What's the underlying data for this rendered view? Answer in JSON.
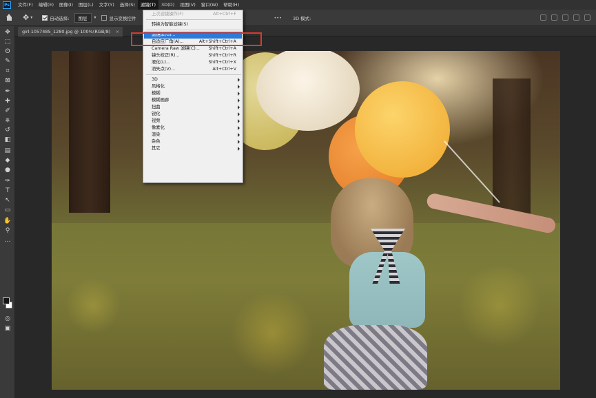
{
  "app": {
    "logo": "Ps"
  },
  "menubar": {
    "items": [
      "文件(F)",
      "编辑(E)",
      "图像(I)",
      "图层(L)",
      "文字(Y)",
      "选择(S)",
      "滤镜(T)",
      "3D(D)",
      "视图(V)",
      "窗口(W)",
      "帮助(H)"
    ],
    "active_index": 6
  },
  "options_bar": {
    "auto_select_label": "自动选择:",
    "auto_select_value": "图层",
    "show_transform_label": "显示变换控件",
    "mode_3d_label": "3D 模式:"
  },
  "document_tab": {
    "title": "girl-1057485_1280.jpg @ 100%(RGB/8)",
    "close": "×"
  },
  "filter_menu": {
    "items": [
      {
        "label": "上次滤镜操作(F)",
        "shortcut": "Alt+Ctrl+F",
        "disabled": true,
        "submenu": false
      },
      {
        "separator": true
      },
      {
        "label": "转换为智能滤镜(S)",
        "shortcut": "",
        "disabled": false,
        "submenu": false
      },
      {
        "separator": true
      },
      {
        "label": "滤镜库(G)...",
        "shortcut": "",
        "disabled": false,
        "submenu": false,
        "highlight": true
      },
      {
        "label": "自适应广角(A)...",
        "shortcut": "Alt+Shift+Ctrl+A",
        "disabled": false,
        "submenu": false
      },
      {
        "label": "Camera Raw 滤镜(C)...",
        "shortcut": "Shift+Ctrl+A",
        "disabled": false,
        "submenu": false
      },
      {
        "label": "镜头校正(R)...",
        "shortcut": "Shift+Ctrl+R",
        "disabled": false,
        "submenu": false
      },
      {
        "label": "液化(L)...",
        "shortcut": "Shift+Ctrl+X",
        "disabled": false,
        "submenu": false
      },
      {
        "label": "消失点(V)...",
        "shortcut": "Alt+Ctrl+V",
        "disabled": false,
        "submenu": false
      },
      {
        "separator": true
      },
      {
        "label": "3D",
        "shortcut": "",
        "disabled": false,
        "submenu": true
      },
      {
        "label": "风格化",
        "shortcut": "",
        "disabled": false,
        "submenu": true
      },
      {
        "label": "模糊",
        "shortcut": "",
        "disabled": false,
        "submenu": true
      },
      {
        "label": "模糊画廊",
        "shortcut": "",
        "disabled": false,
        "submenu": true
      },
      {
        "label": "扭曲",
        "shortcut": "",
        "disabled": false,
        "submenu": true
      },
      {
        "label": "锐化",
        "shortcut": "",
        "disabled": false,
        "submenu": true
      },
      {
        "label": "视频",
        "shortcut": "",
        "disabled": false,
        "submenu": true
      },
      {
        "label": "像素化",
        "shortcut": "",
        "disabled": false,
        "submenu": true
      },
      {
        "label": "渲染",
        "shortcut": "",
        "disabled": false,
        "submenu": true
      },
      {
        "label": "杂色",
        "shortcut": "",
        "disabled": false,
        "submenu": true
      },
      {
        "label": "其它",
        "shortcut": "",
        "disabled": false,
        "submenu": true
      }
    ]
  },
  "toolbar": {
    "tools": [
      "move-icon",
      "marquee-icon",
      "lasso-icon",
      "quick-select-icon",
      "crop-icon",
      "frame-icon",
      "eyedropper-icon",
      "healing-icon",
      "brush-icon",
      "clone-stamp-icon",
      "history-brush-icon",
      "eraser-icon",
      "gradient-icon",
      "blur-icon",
      "dodge-icon",
      "pen-icon",
      "type-icon",
      "path-select-icon",
      "rectangle-icon",
      "hand-icon",
      "zoom-icon",
      "more-tools-icon"
    ],
    "glyphs": [
      "✥",
      "⬚",
      "ʘ",
      "✎",
      "⌗",
      "⊠",
      "✒",
      "✚",
      "✐",
      "⎈",
      "↺",
      "◧",
      "▤",
      "◆",
      "●",
      "✑",
      "T",
      "↖",
      "▭",
      "✋",
      "⚲",
      "…"
    ]
  },
  "colors": {
    "highlight": "#2f7ad8",
    "annotation_box": "#d63b2c",
    "menu_bg": "#f0f0f0"
  }
}
